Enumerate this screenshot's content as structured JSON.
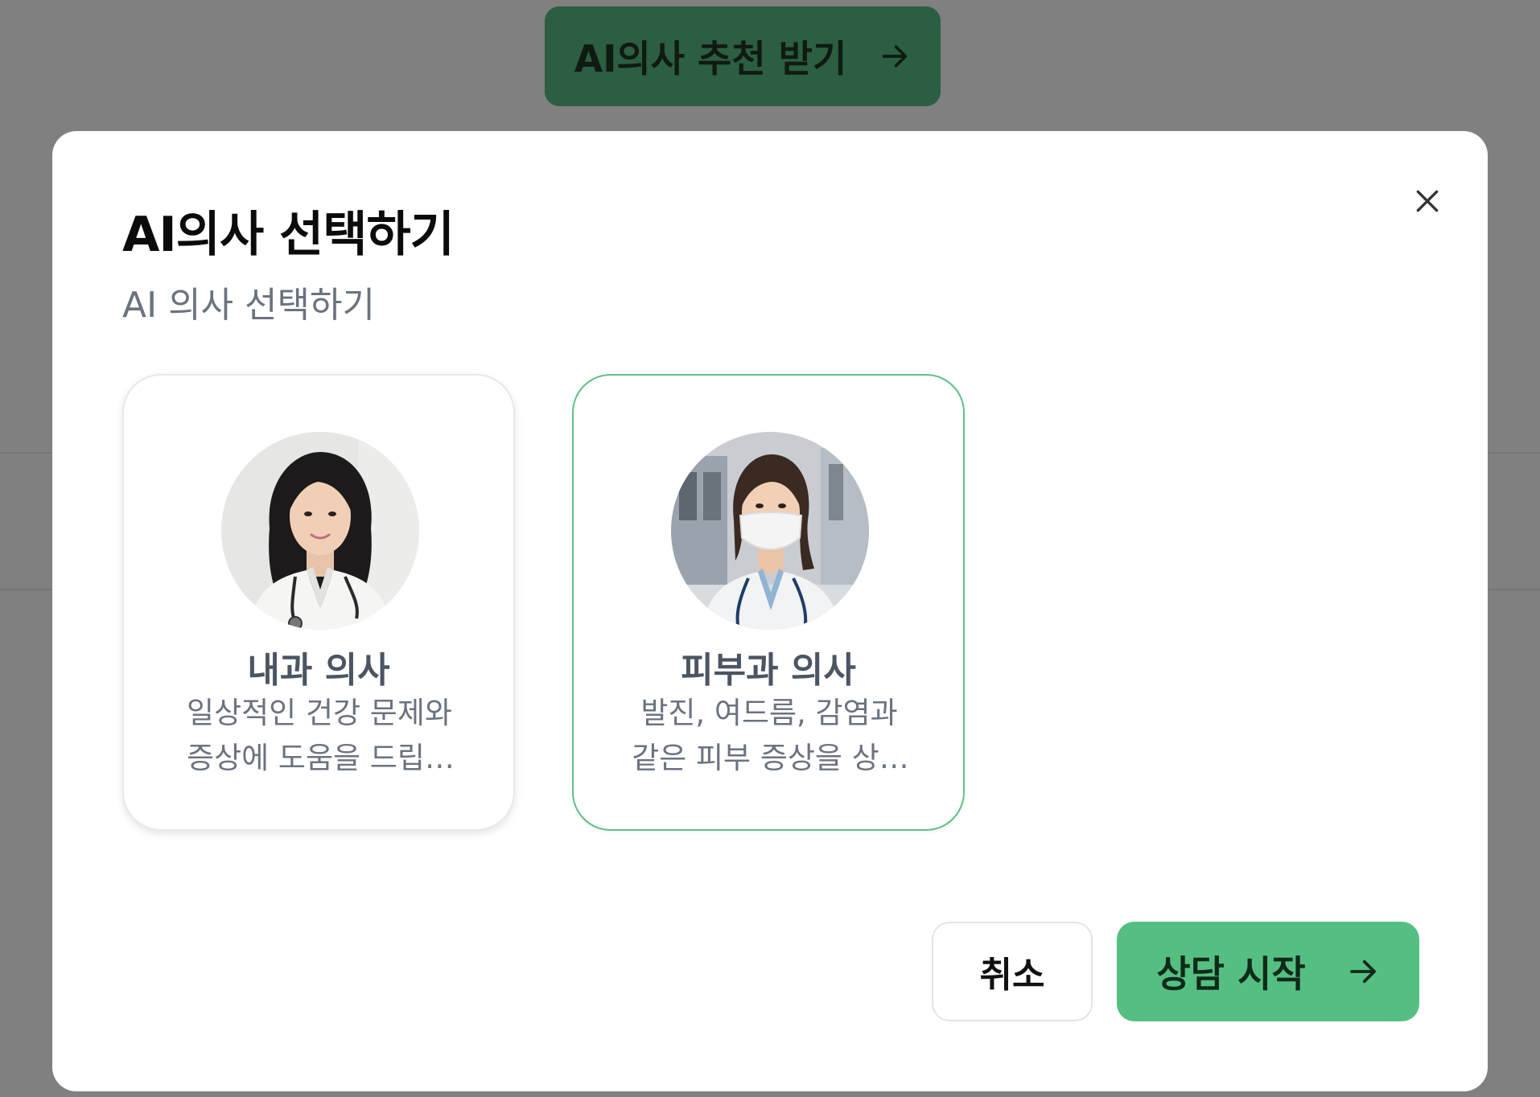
{
  "background": {
    "recommend_button": {
      "label": "AI의사 추천 받기",
      "icon": "arrow-right-icon"
    }
  },
  "modal": {
    "title": "AI의사 선택하기",
    "subtitle": "AI 의사 선택하기",
    "close_icon": "close-icon",
    "doctors": [
      {
        "name": "내과 의사",
        "description": "일상적인 건강 문제와 증상에 도움을 드립니다",
        "selected": false
      },
      {
        "name": "피부과 의사",
        "description": "발진, 여드름, 감염과 같은 피부 증상을 상담합니다",
        "selected": true
      }
    ],
    "cancel_label": "취소",
    "start_label": "상담 시작",
    "start_icon": "arrow-right-icon"
  },
  "colors": {
    "overlay": "#808080",
    "accent": "#55bf82",
    "selected_border": "#5fc085",
    "recommend_button_dimmed": "#2c5e41"
  }
}
